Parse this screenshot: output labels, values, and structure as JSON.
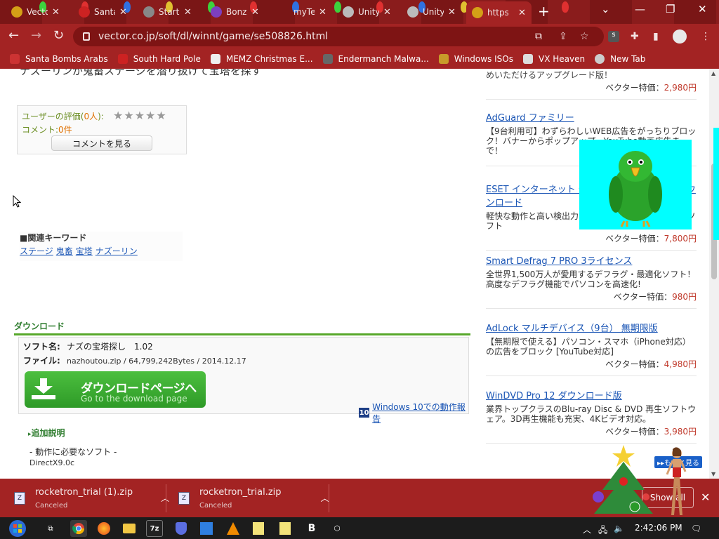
{
  "browser": {
    "tabs": [
      {
        "title": "Vecto",
        "fav": "#d4a017"
      },
      {
        "title": "Santa",
        "fav": "#cc2222"
      },
      {
        "title": "Start",
        "fav": "#888888"
      },
      {
        "title": "Bonz",
        "fav": "#7d3fbf"
      },
      {
        "title": "myTe",
        "fav": "#d0d0d0"
      },
      {
        "title": "Unity",
        "fav": "#d0d0d0"
      },
      {
        "title": "Unity",
        "fav": "#d0d0d0"
      },
      {
        "title": "https",
        "fav": "#d4a017"
      }
    ],
    "url": "vector.co.jp/soft/dl/winnt/game/se508826.html",
    "bookmarks": [
      {
        "label": "Santa Bombs Arabs",
        "color": "#cc3333"
      },
      {
        "label": "South Hard Pole",
        "color": "#cc2222"
      },
      {
        "label": "MEMZ Christmas E...",
        "color": "#eeeeee"
      },
      {
        "label": "Endermanch Malwa...",
        "color": "#666666"
      },
      {
        "label": "Windows ISOs",
        "color": "#c89b2a"
      },
      {
        "label": "VX Heaven",
        "color": "#dddddd"
      },
      {
        "label": "New Tab",
        "color": "#cccccc"
      }
    ]
  },
  "page": {
    "title_cut": "ナズーリンが鬼畜ステージを潜り抜けて宝塔を探す",
    "rating": {
      "label_before": "ユーザーの評価(",
      "count": "0人",
      "label_after": "):",
      "stars": "★★★★★",
      "comment_label": "コメント:",
      "comment_count": "0件",
      "comment_button": "コメントを見る"
    },
    "keywords": {
      "heading": "■関連キーワード",
      "items": [
        "ステージ",
        "鬼畜",
        "宝塔",
        "ナズーリン"
      ]
    },
    "download": {
      "heading": "ダウンロード",
      "soft_label": "ソフト名:",
      "soft_value": "ナズの宝塔探し　1.02",
      "file_label": "ファイル:",
      "file_value": "nazhoutou.zip / 64,799,242Bytes / 2014.12.17",
      "button_line1": "ダウンロードページへ",
      "button_line2": "Go to the download page",
      "win10_badge": "10",
      "win10_link": "Windows 10での動作報告"
    },
    "additional": {
      "heading": "追加説明",
      "req_label": "- 動作に必要なソフト -",
      "req_value": "DirectX9.0c"
    },
    "sidebar": [
      {
        "name": "",
        "desc": "めいただけるアップグレード版！",
        "price_label": "ベクター特価：",
        "price": "2,980円"
      },
      {
        "name": "AdGuard ファミリー",
        "desc": "【9台利用可】わずらわしいWEB広告をがっちりブロック！バナーからポップアップ、YouTube動画広告まで！",
        "price_label": "",
        "price": ""
      },
      {
        "name": "ESET インターネット セキュリティ 1台3年版 ダウンロード",
        "desc": "軽快な動作と高い検出力で、定評のあるセキュリティソフト",
        "price_label": "ベクター特価：",
        "price": "7,800円"
      },
      {
        "name": "Smart Defrag 7 PRO 3ライセンス",
        "desc": "全世界1,500万人が愛用するデフラグ・最適化ソフト！高度なデフラグ機能でパソコンを高速化!",
        "price_label": "ベクター特価：",
        "price": "980円"
      },
      {
        "name": "AdLock マルチデバイス（9台） 無期限版",
        "desc": "【無期限で使える】パソコン・スマホ（iPhone対応）の広告をブロック [YouTube対応]",
        "price_label": "ベクター特価：",
        "price": "4,980円"
      },
      {
        "name": "WinDVD Pro 12 ダウンロード版",
        "desc": "業界トップクラスのBlu-ray Disc & DVD 再生ソフトウェア。3D再生機能も充実、4Kビデオ対応。",
        "price_label": "ベクター特価：",
        "price": "3,980円"
      }
    ],
    "more_button": "▸▸もっと見る"
  },
  "downloads": {
    "items": [
      {
        "filename": "rocketron_trial (1).zip",
        "status": "Canceled"
      },
      {
        "filename": "rocketron_trial.zip",
        "status": "Canceled"
      }
    ],
    "show_all": "Show all"
  },
  "taskbar": {
    "apps": [
      "start",
      "task-view",
      "chrome",
      "firefox",
      "explorer",
      "7zip",
      "app-shield",
      "app-store",
      "vlc",
      "notepad",
      "notepad2",
      "bold-b",
      "unity"
    ],
    "clock": "2:42:06 PM"
  }
}
